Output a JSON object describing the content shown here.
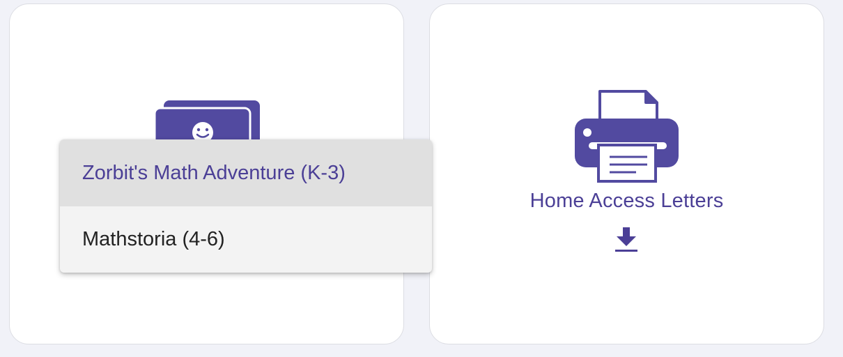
{
  "colors": {
    "accent": "#524aa0",
    "accent_text": "#4b3f96",
    "page_background": "#f1f2f8",
    "card_background": "#ffffff",
    "dropdown_background": "#f3f3f3",
    "dropdown_selected": "#e0e0e0"
  },
  "cards": {
    "left": {
      "icon": "flashcards-icon"
    },
    "right": {
      "icon": "printer-icon",
      "title": "Home Access Letters",
      "action_icon": "download-icon"
    }
  },
  "dropdown": {
    "items": [
      {
        "label": "Zorbit's Math Adventure (K-3)",
        "selected": true
      },
      {
        "label": "Mathstoria (4-6)",
        "selected": false
      }
    ]
  }
}
